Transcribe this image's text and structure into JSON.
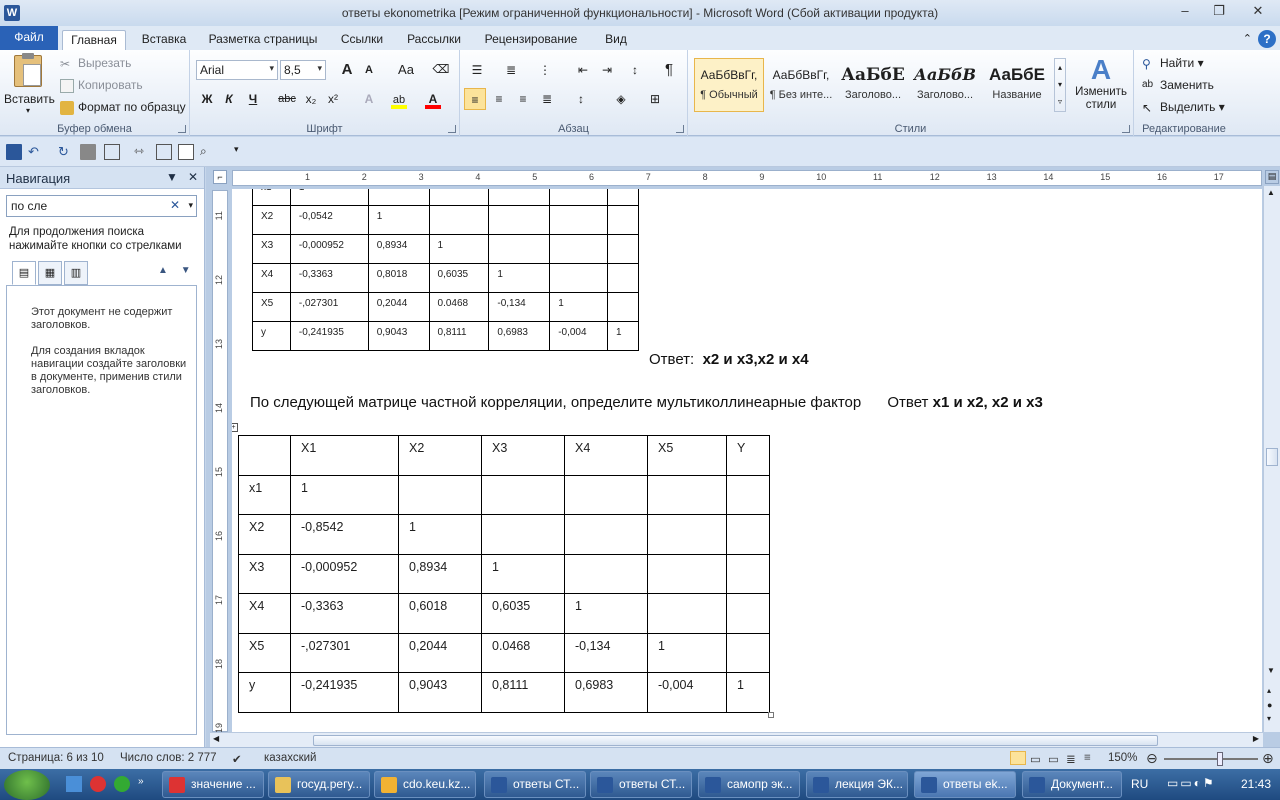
{
  "window": {
    "title": "ответы ekonometrika [Режим ограниченной функциональности]  -  Microsoft Word (Сбой активации продукта)",
    "app_icon": "W",
    "controls": [
      "‒",
      "❐",
      "✕"
    ]
  },
  "tabs": {
    "file": "Файл",
    "items": [
      "Главная",
      "Вставка",
      "Разметка страницы",
      "Ссылки",
      "Рассылки",
      "Рецензирование",
      "Вид"
    ],
    "active": "Главная"
  },
  "ribbon": {
    "clipboard": {
      "label": "Буфер обмена",
      "paste": "Вставить",
      "cut": "Вырезать",
      "copy": "Копировать",
      "format_painter": "Формат по образцу"
    },
    "font": {
      "label": "Шрифт",
      "font_name": "Arial",
      "font_size": "8,5",
      "grow": "A",
      "shrink": "A",
      "case": "Aa",
      "bold": "Ж",
      "italic": "К",
      "underline": "Ч",
      "strike": "abc",
      "subscript": "x₂",
      "superscript": "x²",
      "highlight_color": "#ffff00",
      "font_color": "#ff0000"
    },
    "paragraph": {
      "label": "Абзац",
      "pilcrow": "¶"
    },
    "styles": {
      "label": "Стили",
      "items": [
        {
          "sample": "АаБбВвГг,",
          "name": "¶ Обычный"
        },
        {
          "sample": "АаБбВвГг,",
          "name": "¶ Без инте..."
        },
        {
          "sample": "АаБбЕ",
          "name": "Заголово..."
        },
        {
          "sample": "АаБбВ",
          "name": "Заголово..."
        },
        {
          "sample": "АаБбЕ",
          "name": "Название"
        }
      ],
      "change": "Изменить стили"
    },
    "editing": {
      "label": "Редактирование",
      "find": "Найти",
      "replace": "Заменить",
      "select": "Выделить"
    }
  },
  "nav": {
    "title": "Навигация",
    "search_value": "по сле",
    "hint": "Для продолжения поиска нажимайте кнопки со стрелками",
    "msg1": "Этот документ не содержит заголовков.",
    "msg2": "Для создания вкладок навигации создайте заголовки в документе, применив стили заголовков."
  },
  "document": {
    "ruler_h_numbers": [
      "1",
      "2",
      "3",
      "4",
      "5",
      "6",
      "7",
      "8",
      "9",
      "10",
      "11",
      "12",
      "13",
      "14",
      "15",
      "16",
      "17"
    ],
    "ruler_v_numbers": [
      "11",
      "12",
      "13",
      "14",
      "15",
      "16",
      "17",
      "18",
      "19"
    ],
    "table1": [
      [
        "x1",
        "1",
        "",
        "",
        "",
        "",
        ""
      ],
      [
        "X2",
        "-0,0542",
        "1",
        "",
        "",
        "",
        ""
      ],
      [
        "X3",
        "-0,000952",
        "0,8934",
        "1",
        "",
        "",
        ""
      ],
      [
        "X4",
        "-0,3363",
        "0,8018",
        "0,6035",
        "1",
        "",
        ""
      ],
      [
        "X5",
        "-,027301",
        "0,2044",
        "0.0468",
        "-0,134",
        "1",
        ""
      ],
      [
        "y",
        "-0,241935",
        "0,9043",
        "0,8111",
        "0,6983",
        "-0,004",
        "1"
      ]
    ],
    "answer1_label": "Ответ:",
    "answer1_value": "x2 и x3,x2 и x4",
    "question2": "По следующей матрице частной корреляции, определите мультиколлинеарные фактор",
    "answer2_label": "Ответ",
    "answer2_value": "x1 и x2, x2 и x3",
    "table2": [
      [
        "",
        "X1",
        "X2",
        "X3",
        "X4",
        "X5",
        "Y"
      ],
      [
        "x1",
        "1",
        "",
        "",
        "",
        "",
        ""
      ],
      [
        "X2",
        "-0,8542",
        "1",
        "",
        "",
        "",
        ""
      ],
      [
        "X3",
        "-0,000952",
        "0,8934",
        "1",
        "",
        "",
        ""
      ],
      [
        "X4",
        "-0,3363",
        "0,6018",
        "0,6035",
        "1",
        "",
        ""
      ],
      [
        "X5",
        "-,027301",
        "0,2044",
        "0.0468",
        "-0,134",
        "1",
        ""
      ],
      [
        "y",
        "-0,241935",
        "0,9043",
        "0,8111",
        "0,6983",
        "-0,004",
        "1"
      ]
    ]
  },
  "status": {
    "page": "Страница: 6 из 10",
    "words": "Число слов: 2 777",
    "language": "казахский",
    "zoom": "150%",
    "zoom_level": 0.6
  },
  "taskbar": {
    "items": [
      {
        "label": "значение ...",
        "color": "#d33"
      },
      {
        "label": "госуд.регу...",
        "color": "#e8c25a"
      },
      {
        "label": "cdo.keu.kz...",
        "color": "#f2b233"
      },
      {
        "label": "ответы СТ...",
        "color": "#2b579a"
      },
      {
        "label": "ответы СТ...",
        "color": "#2b579a"
      },
      {
        "label": "самопр эк...",
        "color": "#2b579a"
      },
      {
        "label": "лекция ЭК...",
        "color": "#2b579a"
      },
      {
        "label": "ответы ek...",
        "color": "#2b579a",
        "active": true
      },
      {
        "label": "Документ...",
        "color": "#2b579a"
      }
    ],
    "lang": "RU",
    "time": "21:43"
  }
}
